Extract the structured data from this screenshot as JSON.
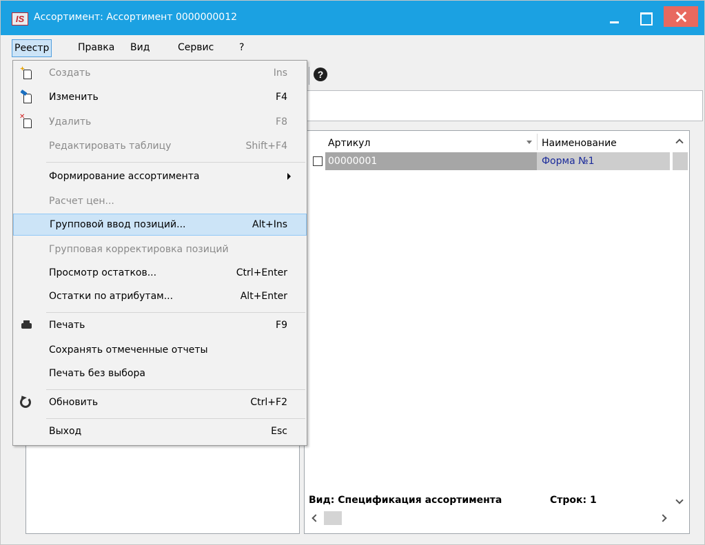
{
  "window": {
    "title": "Ассортимент: Ассортимент 0000000012",
    "logo_text": "IS"
  },
  "menubar": {
    "items": [
      "Реестр",
      "Правка",
      "Вид",
      "Сервис",
      "?"
    ]
  },
  "dropdown": {
    "items": [
      {
        "label": "Создать",
        "shortcut": "Ins",
        "disabled": true,
        "icon": "create-doc-icon"
      },
      {
        "label": "Изменить",
        "shortcut": "F4",
        "disabled": false,
        "icon": "edit-doc-icon"
      },
      {
        "label": "Удалить",
        "shortcut": "F8",
        "disabled": true,
        "icon": "delete-doc-icon"
      },
      {
        "label": "Редактировать таблицу",
        "shortcut": "Shift+F4",
        "disabled": true
      },
      {
        "label": "Формирование ассортимента",
        "shortcut": "",
        "disabled": false,
        "submenu": true
      },
      {
        "label": "Расчет цен...",
        "shortcut": "",
        "disabled": true
      },
      {
        "label": "Групповой ввод позиций...",
        "shortcut": "Alt+Ins",
        "disabled": false,
        "highlighted": true
      },
      {
        "label": "Групповая корректировка позиций",
        "shortcut": "",
        "disabled": true
      },
      {
        "label": "Просмотр остатков...",
        "shortcut": "Ctrl+Enter",
        "disabled": false
      },
      {
        "label": "Остатки по атрибутам...",
        "shortcut": "Alt+Enter",
        "disabled": false
      },
      {
        "label": "Печать",
        "shortcut": "F9",
        "disabled": false,
        "icon": "printer-icon"
      },
      {
        "label": "Сохранять отмеченные отчеты",
        "shortcut": "",
        "disabled": false
      },
      {
        "label": "Печать без выбора",
        "shortcut": "",
        "disabled": false
      },
      {
        "label": "Обновить",
        "shortcut": "Ctrl+F2",
        "disabled": false,
        "icon": "refresh-icon"
      },
      {
        "label": "Выход",
        "shortcut": "Esc",
        "disabled": false
      }
    ]
  },
  "grid": {
    "columns": [
      "Артикул",
      "Наименование"
    ],
    "rows": [
      {
        "article": "00000001",
        "name": "Форма №1"
      }
    ],
    "status_view": "Вид: Спецификация ассортимента",
    "status_rows": "Строк: 1"
  },
  "toolbar": {
    "help_glyph": "?"
  }
}
